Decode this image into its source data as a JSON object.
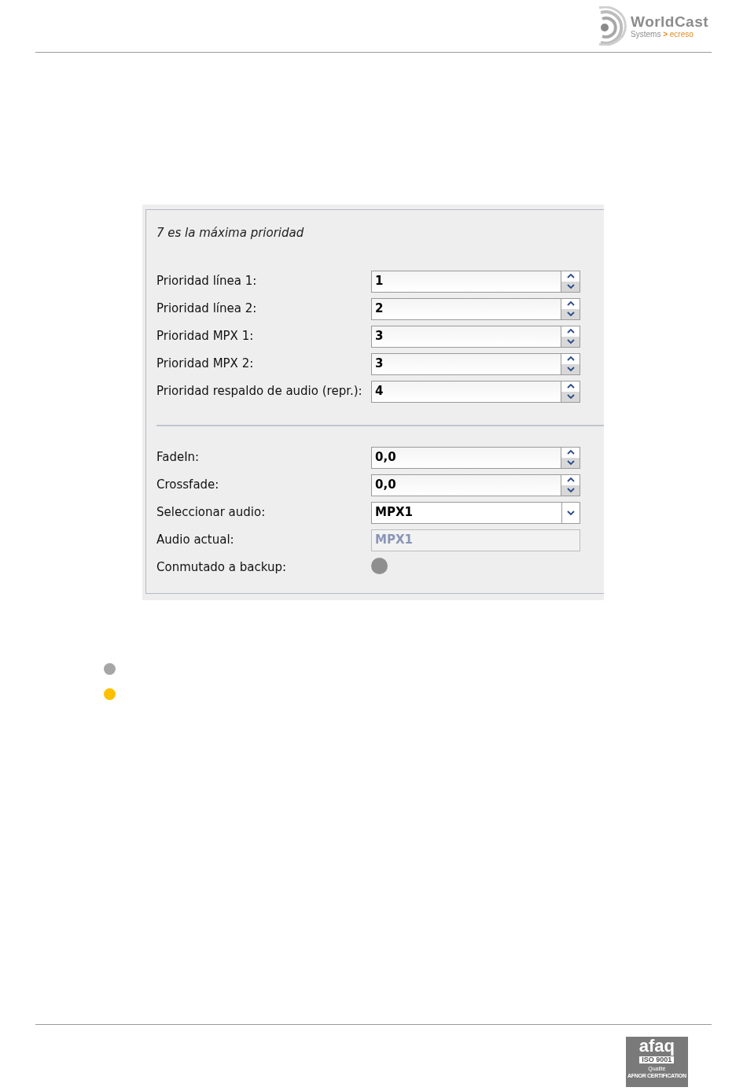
{
  "header": {
    "logo": {
      "name": "WorldCast",
      "tagline": "Systems",
      "separator": ">",
      "brand": "ecreso"
    }
  },
  "panel": {
    "note": "7 es la máxima prioridad",
    "priority_rows": [
      {
        "kind": "spin",
        "label": "Prioridad línea 1:",
        "value": "1"
      },
      {
        "kind": "spin",
        "label": "Prioridad línea 2:",
        "value": "2"
      },
      {
        "kind": "spin",
        "label": "Prioridad MPX 1:",
        "value": "3"
      },
      {
        "kind": "spin",
        "label": "Prioridad MPX 2:",
        "value": "3"
      },
      {
        "kind": "spin",
        "label": "Prioridad respaldo de audio (repr.):",
        "value": "4"
      }
    ],
    "audio_rows": [
      {
        "kind": "spin",
        "label": "FadeIn:",
        "value": "0,0"
      },
      {
        "kind": "spin",
        "label": "Crossfade:",
        "value": "0,0"
      },
      {
        "kind": "select",
        "label": "Seleccionar audio:",
        "value": "MPX1"
      },
      {
        "kind": "readonly",
        "label": "Audio actual:",
        "value": "MPX1"
      },
      {
        "kind": "indicator",
        "label": "Conmutado a backup:",
        "on": false
      }
    ]
  },
  "legend": [
    {
      "color": "#a6a6a6"
    },
    {
      "color": "#ffc000"
    }
  ],
  "footer": {
    "logo": {
      "name": "afaq",
      "standard": "ISO 9001",
      "quality": "Qualité",
      "certifier": "AFNOR CERTIFICATION"
    }
  }
}
